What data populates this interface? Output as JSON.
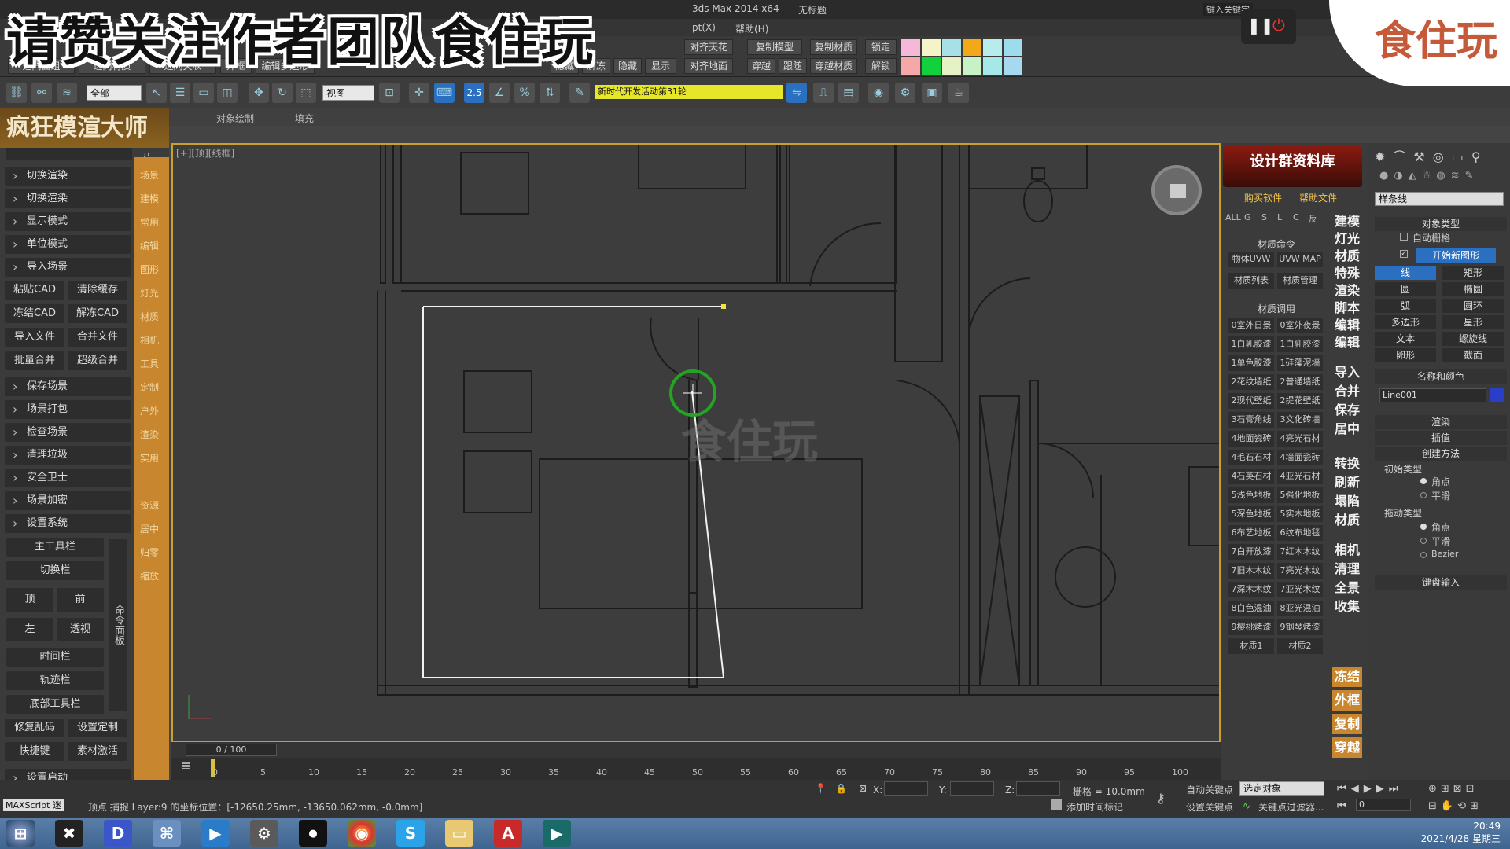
{
  "overlay": {
    "title": "请赞关注作者团队食住玩",
    "logo": "食住玩"
  },
  "window": {
    "title": "3ds Max  2014 x64",
    "doc": "无标题",
    "search_hint": "键入关键字"
  },
  "menubar": {
    "items": [
      "pt(X)",
      "帮助(H)"
    ]
  },
  "toolrow": {
    "buttons_row1": [
      "对齐天花",
      "复制模型",
      "复制材质",
      "锁定"
    ],
    "buttons_row1_left": [
      "(R)"
    ],
    "buttons_row2": [
      "选同面组",
      "选同材质",
      "选同关联",
      "外框",
      "编辑多边形",
      "隐藏",
      "解冻",
      "隐藏",
      "显示",
      "对齐地面",
      "穿越",
      "跟随",
      "穿越材质",
      "解锁"
    ],
    "swatches_top": [
      "#f6b8d8",
      "#f4f4c8",
      "#a8e0e8",
      "#f3a81a",
      "#b8ecec",
      "#9cdcec"
    ],
    "swatches_bottom": [
      "#f4a8a8",
      "#13d13d",
      "#e6f2c6",
      "#c6f2c6",
      "#a6e8e8",
      "#a6d8f0"
    ]
  },
  "maintool": {
    "filter_select": "全部",
    "view_select": "视图",
    "highlight_text": "新时代开发活动第31轮",
    "snap_value": "2.5"
  },
  "ribbon": {
    "items": [
      "对象绘制",
      "填充"
    ]
  },
  "leftpanel": {
    "header": "疯狂模渲大师",
    "menu_items": [
      "切换渲染",
      "切换渲染",
      "显示模式",
      "单位模式",
      "导入场景"
    ],
    "button_pairs": [
      [
        "粘贴CAD",
        "清除缓存"
      ],
      [
        "冻结CAD",
        "解冻CAD"
      ],
      [
        "导入文件",
        "合并文件"
      ],
      [
        "批量合并",
        "超级合并"
      ]
    ],
    "menu_items2": [
      "保存场景",
      "场景打包",
      "检查场景",
      "清理垃圾",
      "安全卫士",
      "场景加密",
      "设置系统"
    ],
    "wide_buttons": [
      "主工具栏",
      "切换栏"
    ],
    "view_buttons": [
      [
        "顶",
        "前"
      ],
      [
        "左",
        "透视"
      ]
    ],
    "wide_buttons2": [
      "时间栏",
      "轨迹栏",
      "底部工具栏"
    ],
    "cmd_label": "命令面板",
    "button_pairs2": [
      [
        "修复乱码",
        "设置定制"
      ],
      [
        "快捷键",
        "素材激活"
      ]
    ],
    "footer": "设置启动",
    "sidebar_tabs": [
      "场景",
      "建模",
      "常用",
      "编辑",
      "图形",
      "灯光",
      "材质",
      "相机",
      "工具",
      "定制",
      "户外",
      "渲染",
      "实用",
      "资源",
      "居中",
      "归零",
      "缩放"
    ]
  },
  "viewport": {
    "label": "[+][顶][线框]",
    "watermark": "食住玩"
  },
  "rightpanel": {
    "banner": "设计群资料库",
    "links": [
      "购买软件",
      "帮助文件"
    ],
    "filters": [
      "ALL",
      "G",
      "S",
      "L",
      "C",
      "反"
    ],
    "section1": "材质命令",
    "cmd_buttons": [
      [
        "物体UVW",
        "UVW MAP"
      ],
      [
        "材质列表",
        "材质管理"
      ]
    ],
    "section2": "材质调用",
    "materials": [
      [
        "0室外日景",
        "0室外夜景"
      ],
      [
        "1白乳胶漆",
        "1白乳胶漆"
      ],
      [
        "1单色胶漆",
        "1硅藻泥墙"
      ],
      [
        "2花纹墙纸",
        "2普通墙纸"
      ],
      [
        "2现代壁纸",
        "2提花壁纸"
      ],
      [
        "3石膏角线",
        "3文化砖墙"
      ],
      [
        "4地面瓷砖",
        "4亮光石材"
      ],
      [
        "4毛石石材",
        "4墙面瓷砖"
      ],
      [
        "4石英石材",
        "4亚光石材"
      ],
      [
        "5浅色地板",
        "5强化地板"
      ],
      [
        "5深色地板",
        "5实木地板"
      ],
      [
        "6布艺地板",
        "6纹布地毯"
      ],
      [
        "7白开放漆",
        "7红木木纹"
      ],
      [
        "7旧木木纹",
        "7亮光木纹"
      ],
      [
        "7深木木纹",
        "7亚光木纹"
      ],
      [
        "8白色混油",
        "8亚光混油"
      ],
      [
        "9樱桃烤漆",
        "9钢琴烤漆"
      ]
    ],
    "bottom_tabs": [
      "材质1",
      "材质2"
    ],
    "vertical_cmds": [
      "建模",
      "灯光",
      "材质",
      "特殊",
      "渲染",
      "脚本",
      "编辑",
      "编辑",
      "导入",
      "合并",
      "保存",
      "居中",
      "转换",
      "刷新",
      "塌陷",
      "材质",
      "相机",
      "清理",
      "全景",
      "收集"
    ],
    "vertical_cmds_yellow": [
      "冻结",
      "外框",
      "复制",
      "穿越"
    ]
  },
  "cmdpanel": {
    "dropdown": "样条线",
    "object_type_hdr": "对象类型",
    "auto_grid": "自动栅格",
    "start_new_shape": "开始新图形",
    "shapes": [
      [
        "线",
        "矩形"
      ],
      [
        "圆",
        "椭圆"
      ],
      [
        "弧",
        "圆环"
      ],
      [
        "多边形",
        "星形"
      ],
      [
        "文本",
        "螺旋线"
      ],
      [
        "卵形",
        "截面"
      ]
    ],
    "name_color_hdr": "名称和颜色",
    "object_name": "Line001",
    "rollouts": [
      "渲染",
      "插值",
      "创建方法"
    ],
    "init_type_hdr": "初始类型",
    "init_options": [
      "角点",
      "平滑"
    ],
    "drag_type_hdr": "拖动类型",
    "drag_options": [
      "角点",
      "平滑",
      "Bezier"
    ],
    "keyboard_hdr": "键盘输入"
  },
  "timeline": {
    "counter": "0 / 100",
    "ticks": [
      "0",
      "5",
      "10",
      "15",
      "20",
      "25",
      "30",
      "35",
      "40",
      "45",
      "50",
      "55",
      "60",
      "65",
      "70",
      "75",
      "80",
      "85",
      "90",
      "95",
      "100"
    ]
  },
  "statusbar": {
    "maxscript": "MAXScript 迷",
    "prompt": "顶点 捕捉 Layer:9 的坐标位置：[-12650.25mm, -13650.062mm, -0.0mm]",
    "x_label": "X:",
    "y_label": "Y:",
    "z_label": "Z:",
    "grid": "栅格 = 10.0mm",
    "autokey": "自动关键点",
    "setkey": "设置关键点",
    "selection": "选定对象",
    "key_filter": "关键点过滤器...",
    "add_time_tag": "添加时间标记",
    "frame": "0"
  },
  "taskbar": {
    "time": "20:49",
    "date": "2021/4/28 星期三"
  }
}
